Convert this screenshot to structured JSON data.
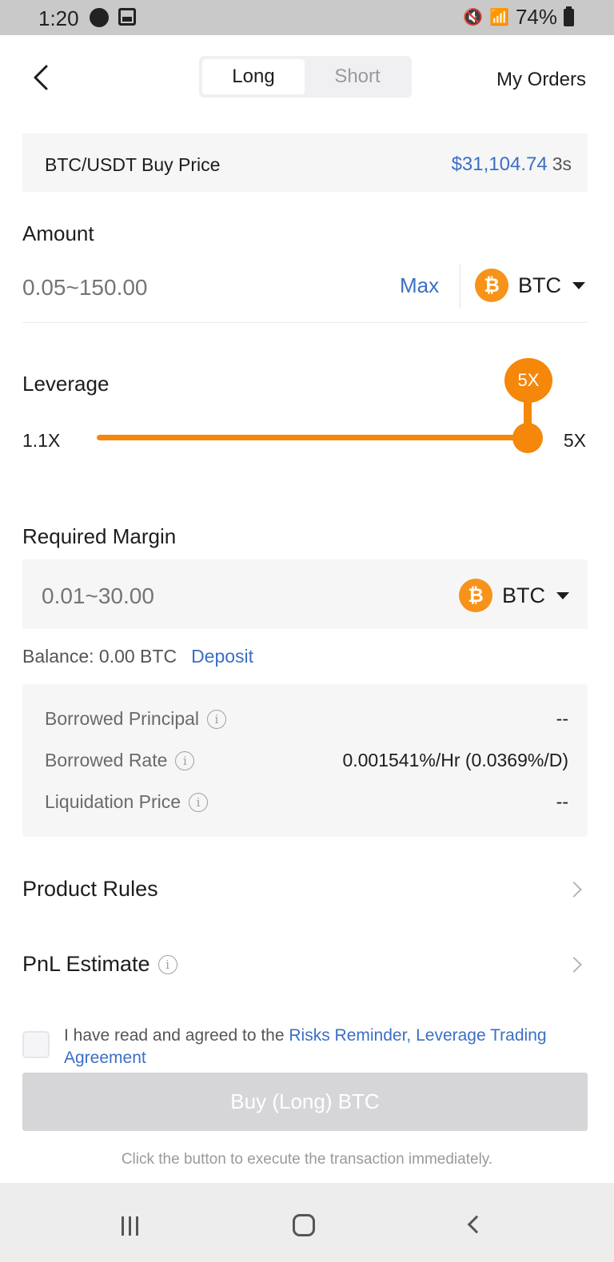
{
  "status_bar": {
    "time": "1:20",
    "battery": "74%"
  },
  "header": {
    "tabs": [
      "Long",
      "Short"
    ],
    "active_tab": "Long",
    "my_orders": "My Orders"
  },
  "price_card": {
    "label": "BTC/USDT Buy Price",
    "price": "$31,104.74",
    "timer": "3s"
  },
  "amount": {
    "title": "Amount",
    "placeholder": "0.05~150.00",
    "max_label": "Max",
    "currency": "BTC"
  },
  "leverage": {
    "title": "Leverage",
    "min_label": "1.1X",
    "max_label": "5X",
    "bubble": "5X",
    "level_fraction": 1.0
  },
  "required_margin": {
    "title": "Required Margin",
    "placeholder": "0.01~30.00",
    "currency": "BTC"
  },
  "balance": {
    "text": "Balance: 0.00 BTC",
    "deposit_label": "Deposit"
  },
  "info": {
    "rows": [
      {
        "label": "Borrowed Principal",
        "value": "--"
      },
      {
        "label": "Borrowed Rate",
        "value": "0.001541%/Hr (0.0369%/D)"
      },
      {
        "label": "Liquidation Price",
        "value": "--"
      }
    ]
  },
  "links": {
    "product_rules": "Product Rules",
    "pnl_estimate": "PnL Estimate"
  },
  "agreement": {
    "prefix": "I have read and agreed to the ",
    "link": "Risks Reminder, Leverage Trading Agreement"
  },
  "buy_button": "Buy (Long) BTC",
  "hint": "Click the button to execute the transaction immediately.",
  "colors": {
    "accent_orange": "#f5870a",
    "link_blue": "#3b6fc4",
    "btc_orange": "#f7931a",
    "disabled_button": "#d6d6d8"
  },
  "icons": [
    "back-chevron",
    "btc-coin",
    "caret-down",
    "info-circle",
    "chevron-right",
    "checkbox"
  ]
}
